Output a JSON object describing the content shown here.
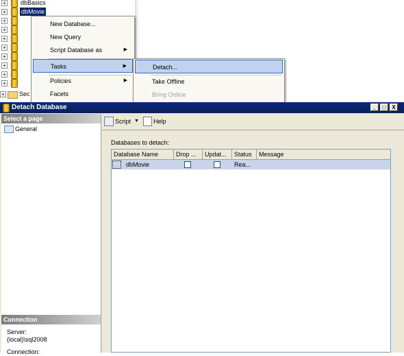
{
  "tree": {
    "rows": [
      {
        "label": "dbBasics",
        "selected": false,
        "kind": "db"
      },
      {
        "label": "dbMovie",
        "selected": true,
        "kind": "db"
      },
      {
        "label": "",
        "selected": false,
        "kind": "db"
      },
      {
        "label": "",
        "selected": false,
        "kind": "db"
      },
      {
        "label": "",
        "selected": false,
        "kind": "db"
      },
      {
        "label": "",
        "selected": false,
        "kind": "db"
      },
      {
        "label": "",
        "selected": false,
        "kind": "db"
      },
      {
        "label": "",
        "selected": false,
        "kind": "db"
      },
      {
        "label": "",
        "selected": false,
        "kind": "db"
      },
      {
        "label": "",
        "selected": false,
        "kind": "db"
      },
      {
        "label": "Sec",
        "selected": false,
        "kind": "folder"
      }
    ]
  },
  "context_menu": {
    "items": [
      {
        "label": "New Database...",
        "submenu": false
      },
      {
        "label": "New Query",
        "submenu": false
      },
      {
        "label": "Script Database as",
        "submenu": true
      },
      {
        "label": "Tasks",
        "submenu": true,
        "highlighted": true
      },
      {
        "label": "Policies",
        "submenu": true
      },
      {
        "label": "Facets",
        "submenu": false
      }
    ]
  },
  "tasks_submenu": {
    "items": [
      {
        "label": "Detach...",
        "highlighted": true
      },
      {
        "label": "Take Offline"
      },
      {
        "label": "Bring Online",
        "disabled": true
      }
    ]
  },
  "dialog": {
    "title": "Detach Database",
    "window_buttons": {
      "minimize": "_",
      "maximize": "□",
      "close": "X"
    },
    "left": {
      "select_page_header": "Select a page",
      "general": "General",
      "connection_header": "Connection",
      "server_label": "Server:",
      "server_value": "(local)\\sql2008",
      "connection_label": "Connection:"
    },
    "toolbar": {
      "script_label": "Script",
      "help_label": "Help"
    },
    "databases_label": "Databases to detach:",
    "grid": {
      "columns": [
        "Database Name",
        "Drop ...",
        "Updat...",
        "Status",
        "Message"
      ],
      "rows": [
        {
          "database_name": "dbMovie",
          "drop": false,
          "update": false,
          "status": "Rea...",
          "message": ""
        }
      ]
    }
  },
  "colors": {
    "title_bar": "#0a246a",
    "selection": "#c8d4e9",
    "menu_highlight": "#c1d2ee"
  }
}
